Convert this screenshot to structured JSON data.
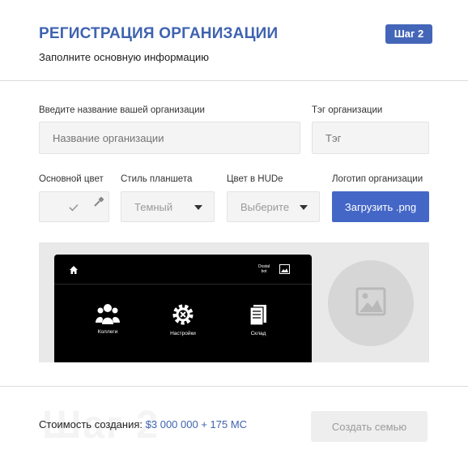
{
  "header": {
    "title": "РЕГИСТРАЦИЯ ОРГАНИЗАЦИИ",
    "subtitle": "Заполните основную информацию",
    "step_badge": "Шаг 2"
  },
  "form": {
    "org_name": {
      "label": "Введите название вашей организации",
      "placeholder": "Название организации",
      "value": ""
    },
    "org_tag": {
      "label": "Тэг организации",
      "placeholder": "Тэг",
      "value": ""
    },
    "main_color": {
      "label": "Основной цвет",
      "icons": [
        "check-icon",
        "eyedropper-icon"
      ]
    },
    "tablet_style": {
      "label": "Стиль планшета",
      "selected": "Темный"
    },
    "hud_color": {
      "label": "Цвет в HUDe",
      "selected": "Выберите"
    },
    "logo": {
      "label": "Логотип организации",
      "button": "Загрузить .png"
    }
  },
  "preview": {
    "brand_line1": "Dostal",
    "brand_line2": "bot",
    "items": [
      {
        "label": "Коллеги",
        "icon": "people-icon"
      },
      {
        "label": "Настройки",
        "icon": "gear-icon"
      },
      {
        "label": "Склад",
        "icon": "documents-icon"
      }
    ]
  },
  "footer": {
    "watermark": "Шаг 2",
    "cost_label": "Стоимость создания:",
    "cost_value": "$3 000 000 + 175 MC",
    "create_button": "Создать семью"
  }
}
